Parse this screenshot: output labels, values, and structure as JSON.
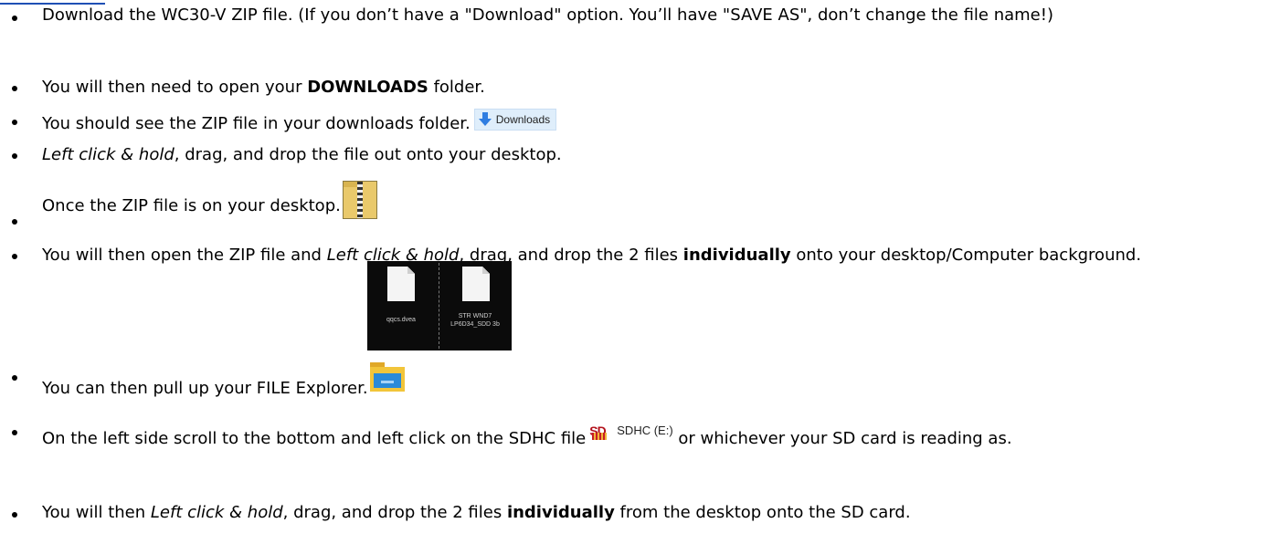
{
  "steps": {
    "s1": {
      "text": "Download the WC30-V ZIP file. (If you don’t have a \"Download\" option. You’ll have \"SAVE AS\", don’t change the file name!)"
    },
    "s2": {
      "pre": "You will then need to open your ",
      "bold": "DOWNLOADS",
      "post": " folder."
    },
    "s3": {
      "text": "You should see the ZIP file in your downloads folder.",
      "badge_label": "Downloads",
      "badge_icon": "download-arrow-icon"
    },
    "s4": {
      "italic": "Left click & hold",
      "post": ", drag, and drop the file out onto your desktop."
    },
    "s5": {
      "text": "Once the ZIP file is on your desktop.",
      "icon": "zip-folder-icon"
    },
    "s6": {
      "pre": "You will then open the ZIP file and ",
      "italic": "Left click & hold",
      "mid": ", drag, and drop the 2 files ",
      "bold": "individually",
      "post": " onto your desktop/Computer background.",
      "file1_label": "qqcs.dvea",
      "file2_label": "STR WND7 LP6D34_SDD 3b",
      "image": "two-files-on-black-image"
    },
    "s7": {
      "text": "You can then pull up your FILE Explorer.",
      "icon": "file-explorer-icon"
    },
    "s8": {
      "pre": "On the left side scroll to the bottom and left click on the SDHC file",
      "sd_logo_text": "SD",
      "sd_label": "SDHC (E:)",
      "post": " or whichever your SD card is reading as."
    },
    "s9": {
      "pre": "You will then ",
      "italic": "Left click & hold",
      "mid": ", drag, and drop the 2 files ",
      "bold": "individually",
      "post": " from the desktop onto the SD card."
    }
  },
  "colors": {
    "link_underline": "#1f4fb5",
    "downloads_badge_bg": "#dfeefb",
    "sd_red": "#b3121c"
  }
}
